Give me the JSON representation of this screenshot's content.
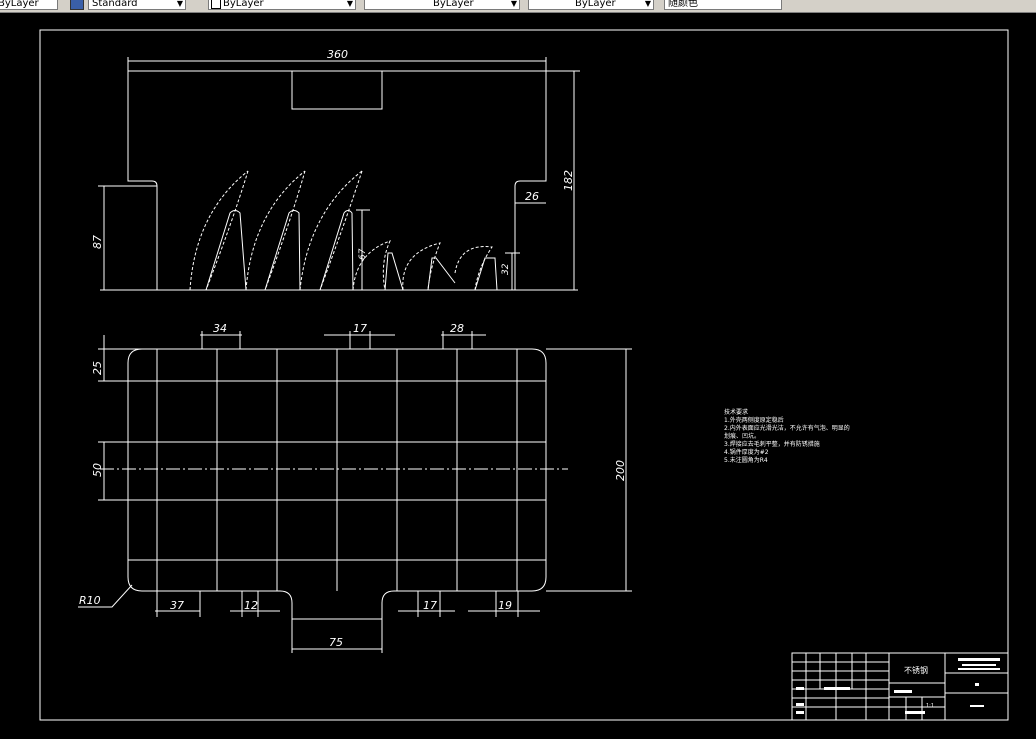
{
  "toolbar": {
    "layer_combo": "ByLayer",
    "style_combo": "Standard",
    "color_combo": "ByLayer",
    "linetype_combo": "ByLayer",
    "lineweight_combo": "ByLayer",
    "plotstyle_combo": "随颜色",
    "left_fragment": "ByLayer"
  },
  "drawing": {
    "dims_top": {
      "width": "360",
      "height": "182",
      "left_height": "87",
      "step_width": "26",
      "slot_height": "67",
      "small_height": "32"
    },
    "dims_bottom": {
      "d34": "34",
      "d17": "17",
      "d28": "28",
      "d25": "25",
      "d50": "50",
      "d200": "200",
      "d37": "37",
      "d12": "12",
      "d75": "75",
      "d17b": "17",
      "d19": "19",
      "radius": "R10"
    },
    "tech_requirements": {
      "title": "技术要求",
      "lines": [
        "1.外壳两侧度原定稳后",
        "2.内外表面应光滑光洁，不允许有气泡、明显的",
        "划痕、凹坑。",
        "3.焊接应去毛刺平整，并有防锈措施",
        "4.锅件厚度为#2",
        "5.未注圆角为R4"
      ]
    },
    "title_block": {
      "material": "不锈钢",
      "scale": "1:1"
    }
  },
  "colors": {
    "background": "#000000",
    "line": "#ffffff",
    "toolbar": "#d4d0c8"
  }
}
